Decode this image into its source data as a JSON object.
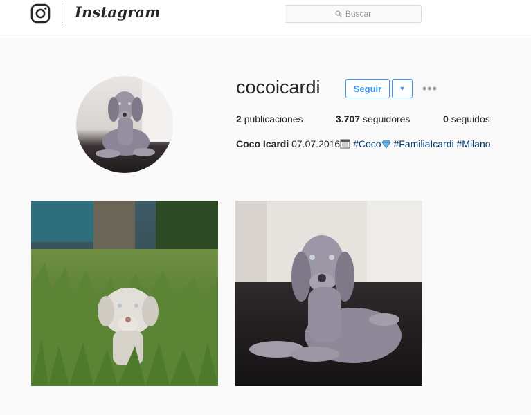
{
  "header": {
    "logo_icon": "instagram-camera-icon",
    "wordmark": "Instagram",
    "search_placeholder": "Buscar",
    "search_icon": "search-icon"
  },
  "profile": {
    "username": "cocoicardi",
    "follow_label": "Seguir",
    "dropdown_icon": "chevron-down-icon",
    "more_icon": "more-options-icon",
    "stats": {
      "posts_count": "2",
      "posts_label": "publicaciones",
      "followers_count": "3.707",
      "followers_label": "seguidores",
      "following_count": "0",
      "following_label": "seguidos"
    },
    "bio": {
      "name": "Coco Icardi",
      "date": "07.07.2016",
      "calendar_icon": "calendar-icon",
      "tag1": "#Coco",
      "gem_icon": "gem-icon",
      "tag2": "#FamiliaIcardi",
      "tag3": "#Milano"
    }
  },
  "colors": {
    "accent": "#3897f0",
    "link": "#003569",
    "text": "#262626",
    "background": "#fafafa",
    "border": "#dbdbdb"
  },
  "posts": [
    {
      "subject": "puppy-in-grass-photo"
    },
    {
      "subject": "puppy-lying-on-floor-photo"
    }
  ]
}
